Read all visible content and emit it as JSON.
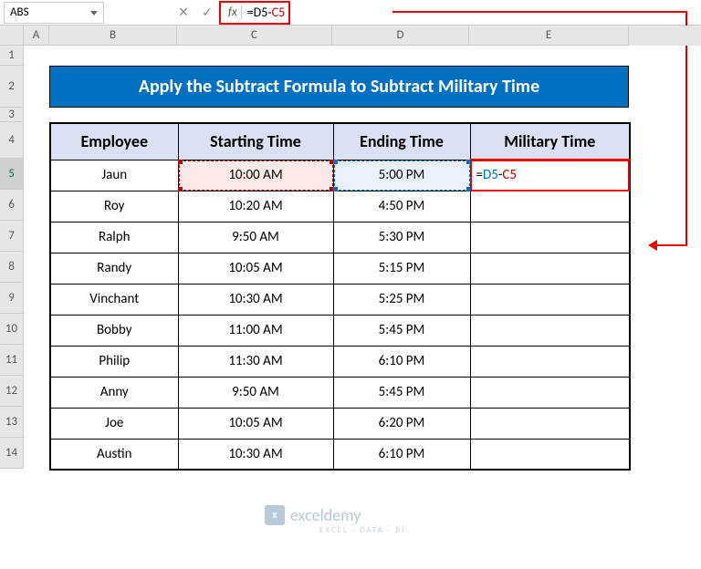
{
  "nameBox": "ABS",
  "formulaBar": {
    "fxLabel": "fx",
    "eq": "=",
    "d5": "D5",
    "dash": "-",
    "c5": "C5"
  },
  "columns": [
    "A",
    "B",
    "C",
    "D",
    "E"
  ],
  "rowNums": [
    "1",
    "2",
    "3",
    "4",
    "5",
    "6",
    "7",
    "8",
    "9",
    "10",
    "11",
    "12",
    "13",
    "14"
  ],
  "title": "Apply the Subtract Formula to Subtract Military Time",
  "headers": {
    "b": "Employee",
    "c": "Starting Time",
    "d": "Ending Time",
    "e": "Military Time"
  },
  "rows": [
    {
      "b": "Jaun",
      "c": "10:00 AM",
      "d": "5:00 PM"
    },
    {
      "b": "Roy",
      "c": "10:20 AM",
      "d": "4:50 PM"
    },
    {
      "b": "Ralph",
      "c": "9:50 AM",
      "d": "5:30 PM"
    },
    {
      "b": "Randy",
      "c": "10:05 AM",
      "d": "5:15 PM"
    },
    {
      "b": "Vinchant",
      "c": "10:30 AM",
      "d": "5:25 PM"
    },
    {
      "b": "Bobby",
      "c": "11:00 AM",
      "d": "5:45 PM"
    },
    {
      "b": "Philip",
      "c": "11:30 AM",
      "d": "6:10 PM"
    },
    {
      "b": "Anny",
      "c": "9:50 AM",
      "d": "5:45 PM"
    },
    {
      "b": "Joe",
      "c": "10:05 AM",
      "d": "6:20 PM"
    },
    {
      "b": "Austin",
      "c": "10:30 AM",
      "d": "6:10 PM"
    }
  ],
  "cellE5": {
    "eq": "=",
    "d5": "D5",
    "dash": "-",
    "c5": "C5"
  },
  "watermark": {
    "name": "exceldemy",
    "sub": "EXCEL · DATA · BI"
  }
}
